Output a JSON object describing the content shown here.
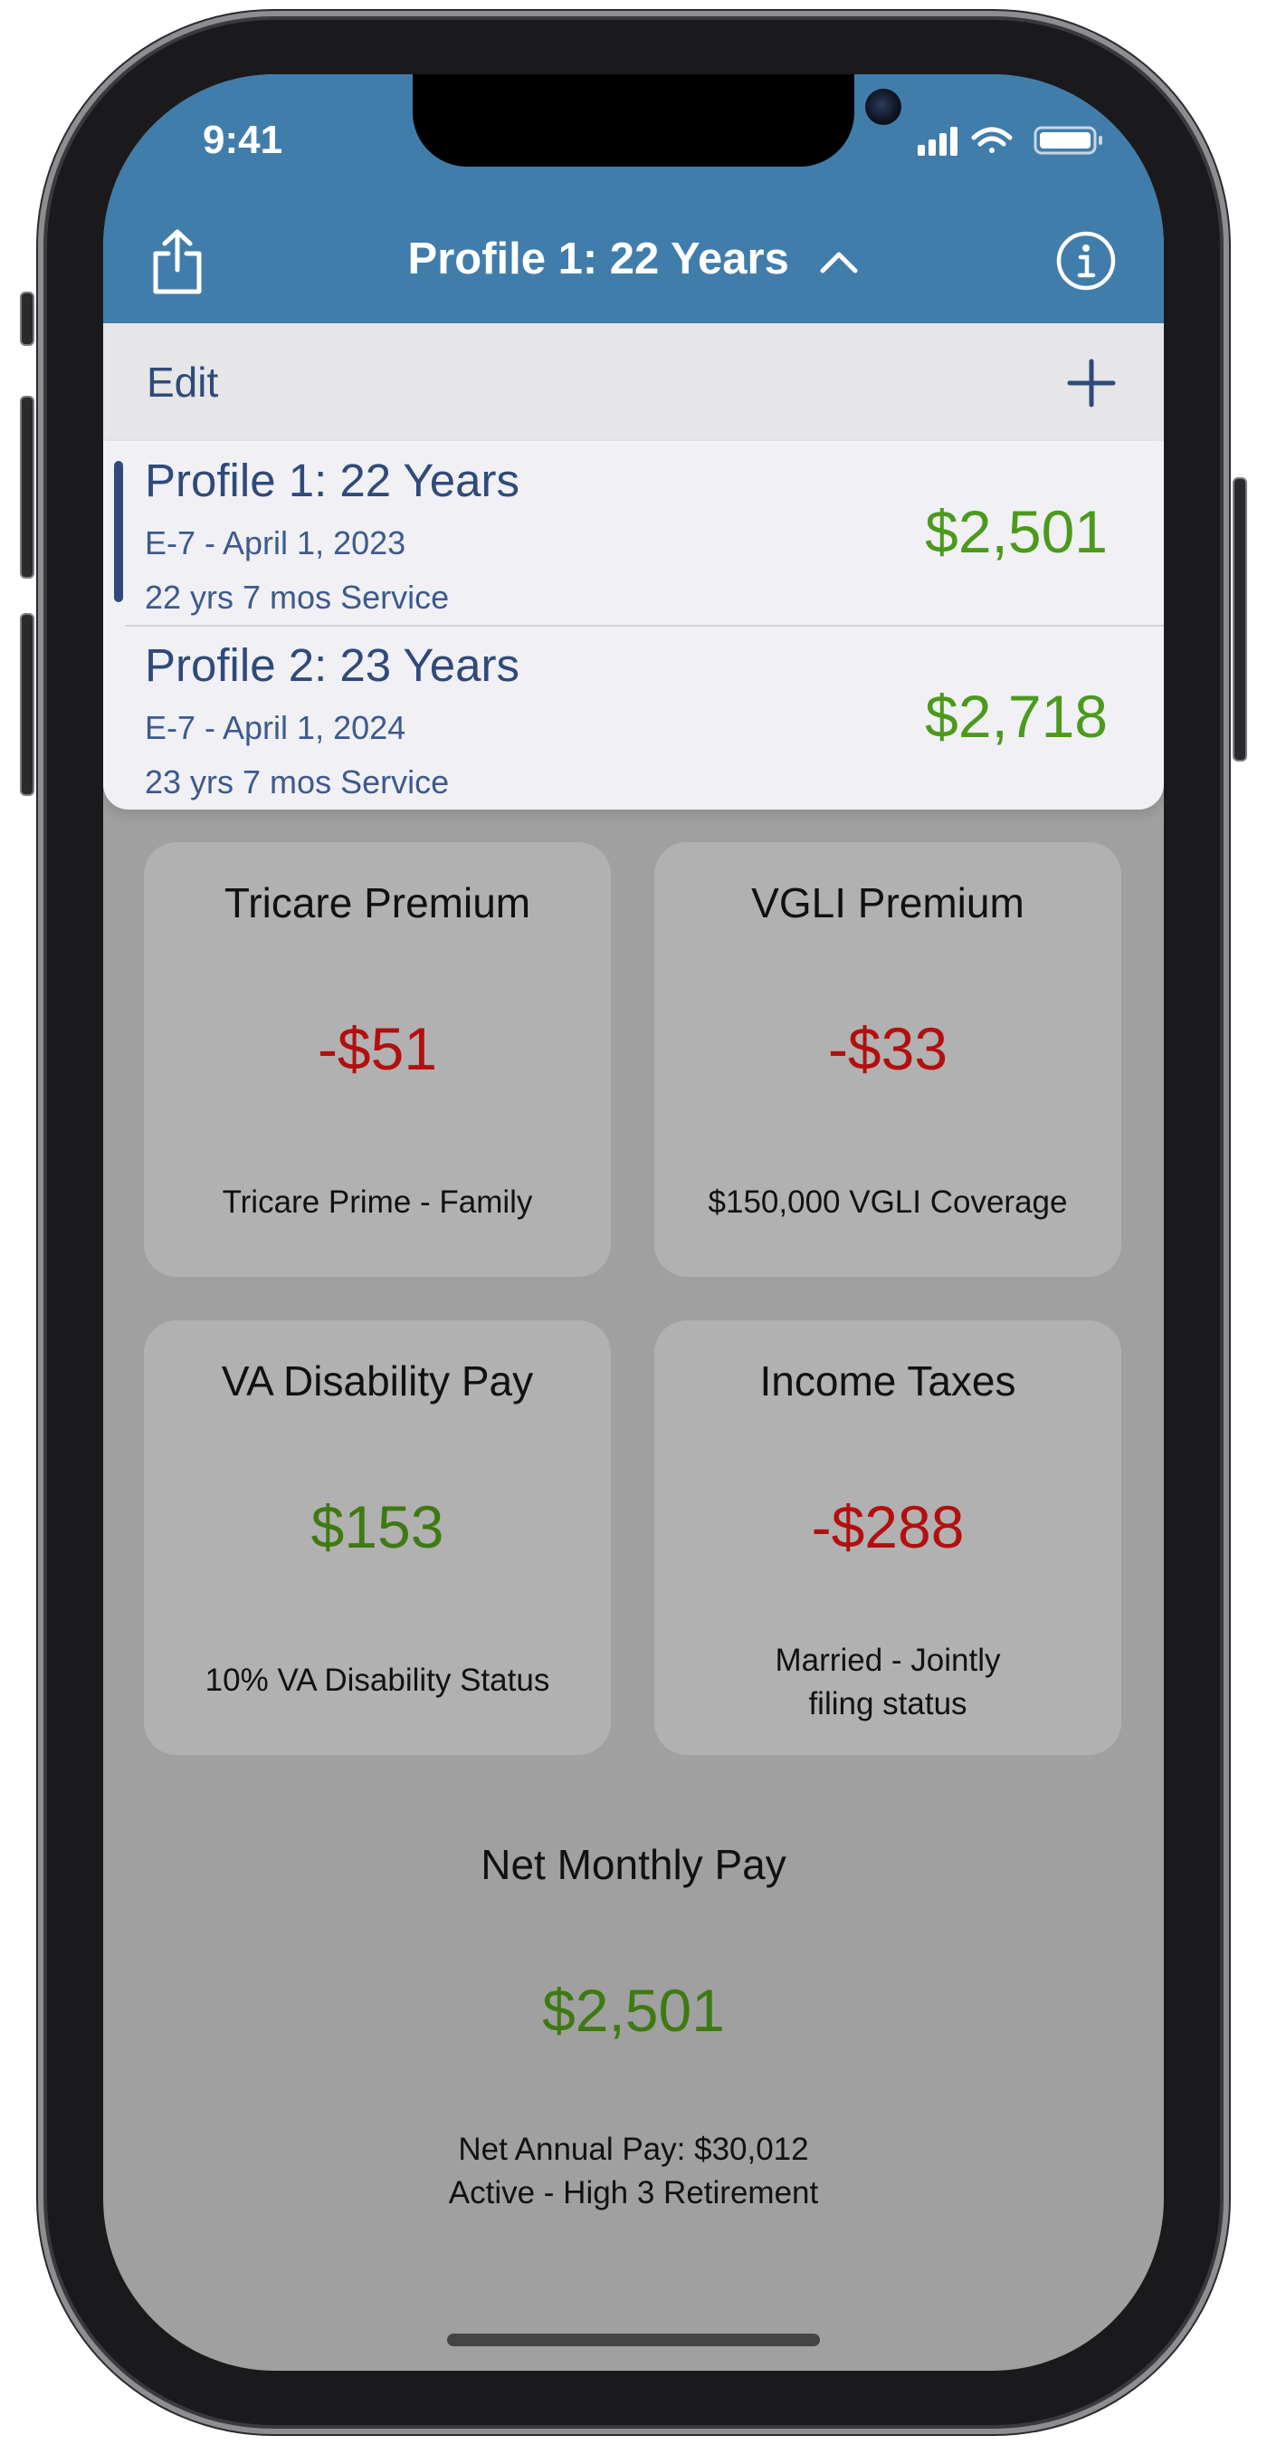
{
  "status_bar": {
    "time": "9:41"
  },
  "nav": {
    "title": "Profile 1: 22 Years"
  },
  "edit_bar": {
    "edit_label": "Edit"
  },
  "profiles": [
    {
      "name": "Profile 1: 22 Years",
      "date": "E-7 - April 1, 2023",
      "service": "22 yrs 7 mos Service",
      "pay": "$2,501",
      "selected": true
    },
    {
      "name": "Profile 2: 23 Years",
      "date": "E-7 - April 1, 2024",
      "service": "23 yrs 7 mos Service",
      "pay": "$2,718",
      "selected": false
    }
  ],
  "cards": [
    {
      "title": "Tricare Premium",
      "value": "-$51",
      "sub": "Tricare Prime - Family"
    },
    {
      "title": "VGLI Premium",
      "value": "-$33",
      "sub": "$150,000 VGLI Coverage"
    },
    {
      "title": "VA Disability Pay",
      "value": "$153",
      "sub": "10% VA Disability Status"
    },
    {
      "title": "Income Taxes",
      "value": "-$288",
      "sub": "Married - Jointly filing status"
    }
  ],
  "net": {
    "title": "Net Monthly Pay",
    "value": "$2,501",
    "annual": "Net Annual Pay: $30,012",
    "retirement": "Active - High 3 Retirement"
  },
  "colors": {
    "header": "#417dab",
    "accent": "#2f4a7a",
    "positive": "#4c9a1c",
    "negative": "#b30f0f"
  },
  "icons": [
    "share-icon",
    "chevron-up-icon",
    "info-icon",
    "plus-icon",
    "signal-icon",
    "wifi-icon",
    "battery-icon"
  ]
}
